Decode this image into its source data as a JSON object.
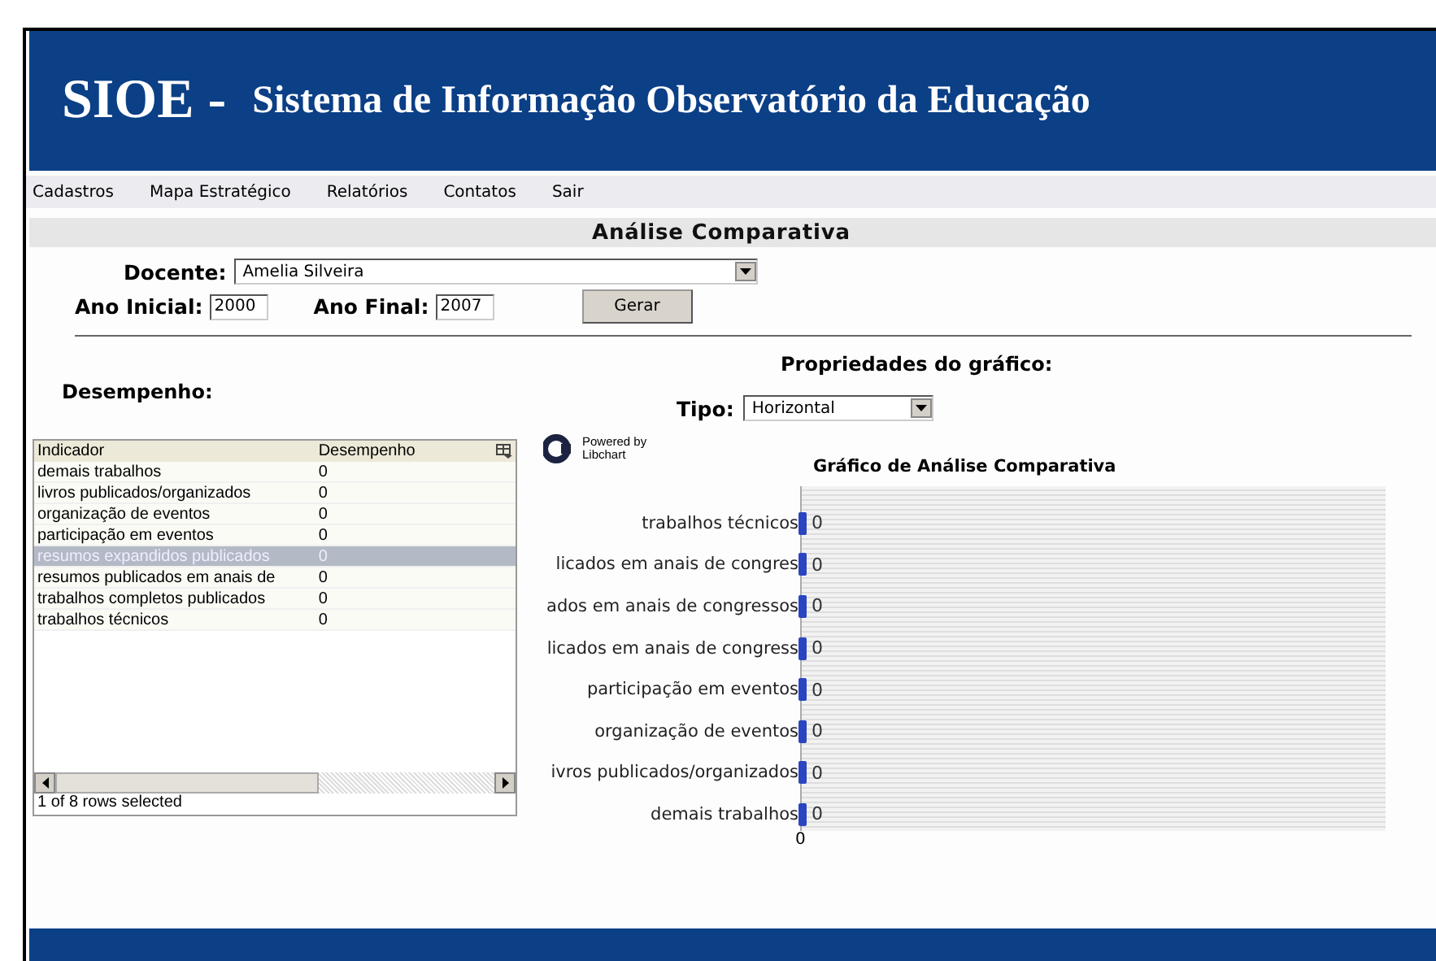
{
  "header": {
    "logo": "SIOE -",
    "title": "Sistema de Informação Observatório da Educação"
  },
  "menu": [
    "Cadastros",
    "Mapa Estratégico",
    "Relatórios",
    "Contatos",
    "Sair"
  ],
  "section_title": "Análise Comparativa",
  "form": {
    "docente_label": "Docente:",
    "docente_value": "Amelia Silveira",
    "ano_inicial_label": "Ano Inicial:",
    "ano_inicial_value": "2000",
    "ano_final_label": "Ano Final:",
    "ano_final_value": "2007",
    "button": "Gerar"
  },
  "performance_label": "Desempenho:",
  "chart_properties": {
    "title": "Propriedades do gráfico:",
    "tipo_label": "Tipo:",
    "tipo_value": "Horizontal"
  },
  "table": {
    "columns": [
      "Indicador",
      "Desempenho"
    ],
    "rows": [
      {
        "indicador": "demais trabalhos",
        "desempenho": "0",
        "selected": false
      },
      {
        "indicador": "livros publicados/organizados",
        "desempenho": "0",
        "selected": false
      },
      {
        "indicador": "organização de eventos",
        "desempenho": "0",
        "selected": false
      },
      {
        "indicador": "participação em eventos",
        "desempenho": "0",
        "selected": false
      },
      {
        "indicador": "resumos expandidos publicados",
        "desempenho": "0",
        "selected": true
      },
      {
        "indicador": "resumos publicados em anais de",
        "desempenho": "0",
        "selected": false
      },
      {
        "indicador": "trabalhos completos publicados",
        "desempenho": "0",
        "selected": false
      },
      {
        "indicador": "trabalhos técnicos",
        "desempenho": "0",
        "selected": false
      }
    ],
    "status": "1 of 8 rows selected"
  },
  "chart": {
    "powered_by": "Powered by",
    "brand": "Libchart",
    "title": "Gráfico de Análise Comparativa",
    "bars": [
      {
        "label": "trabalhos técnicos",
        "value": "0"
      },
      {
        "label": "licados em anais de congres",
        "value": "0"
      },
      {
        "label": "ados em anais de congressos",
        "value": "0"
      },
      {
        "label": "licados em anais de congress",
        "value": "0"
      },
      {
        "label": "participação em eventos",
        "value": "0"
      },
      {
        "label": "organização de eventos",
        "value": "0"
      },
      {
        "label": "ivros publicados/organizados",
        "value": "0"
      },
      {
        "label": "demais trabalhos",
        "value": "0"
      }
    ],
    "axis_tick": "0"
  }
}
